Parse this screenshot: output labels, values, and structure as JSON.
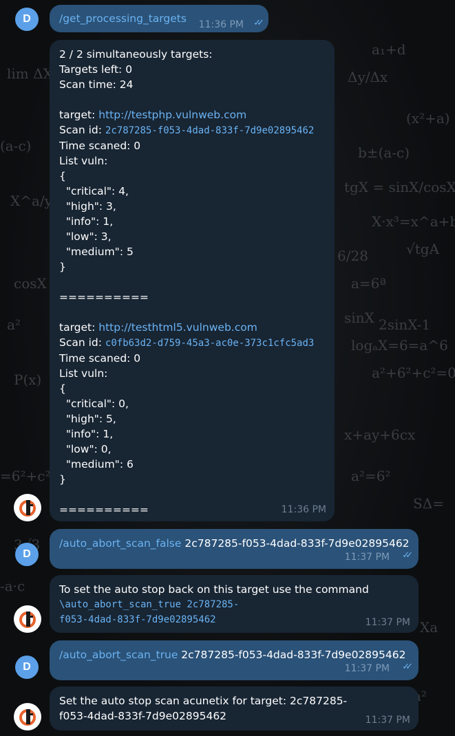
{
  "messages": {
    "m1": {
      "sender_initial": "D",
      "command": "/get_processing_targets",
      "time": "11:36 PM"
    },
    "m2": {
      "header": [
        "2 / 2 simultaneously targets:",
        "Targets left: 0",
        "Scan time: 24"
      ],
      "targets": [
        {
          "target_label": "target: ",
          "target_url": "http://testphp.vulnweb.com",
          "scan_id_label": "Scan id: ",
          "scan_id": "2c787285-f053-4dad-833f-7d9e02895462",
          "time_scanned": "Time scaned: 0",
          "list_vuln": "List vuln:",
          "open_brace": "{",
          "critical": "  \"critical\": 4,",
          "high": "  \"high\": 3,",
          "info": "  \"info\": 1,",
          "low": "  \"low\": 3,",
          "medium": "  \"medium\": 5",
          "close_brace": "}",
          "separator": "=========="
        },
        {
          "target_label": "target: ",
          "target_url": "http://testhtml5.vulnweb.com",
          "scan_id_label": "Scan id: ",
          "scan_id": "c0fb63d2-d759-45a3-ac0e-373c1cfc5ad3",
          "time_scanned": "Time scaned: 0",
          "list_vuln": "List vuln:",
          "open_brace": "{",
          "critical": "  \"critical\": 0,",
          "high": "  \"high\": 5,",
          "info": "  \"info\": 1,",
          "low": "  \"low\": 0,",
          "medium": "  \"medium\": 6",
          "close_brace": "}",
          "separator": "=========="
        }
      ],
      "time": "11:36 PM"
    },
    "m3": {
      "sender_initial": "D",
      "command": "/auto_abort_scan_false",
      "arg": " 2c787285-f053-4dad-833f-7d9e02895462",
      "time": "11:37 PM"
    },
    "m4": {
      "text": "To set the auto stop back on this target use the command",
      "code_line1": "\\auto_abort_scan_true 2c787285-",
      "code_line2": "f053-4dad-833f-7d9e02895462",
      "time": "11:37 PM"
    },
    "m5": {
      "sender_initial": "D",
      "command": "/auto_abort_scan_true",
      "arg": " 2c787285-f053-4dad-833f-7d9e02895462",
      "time": "11:37 PM"
    },
    "m6": {
      "line1": "Set the auto stop scan acunetix for target: 2c787285-",
      "line2": "f053-4dad-833f-7d9e02895462",
      "time": "11:37 PM"
    }
  },
  "colors": {
    "outgoing_bubble": "#2b5278",
    "incoming_bubble": "#182533",
    "link": "#6ab3f3",
    "avatar": "#5ba0e8"
  }
}
